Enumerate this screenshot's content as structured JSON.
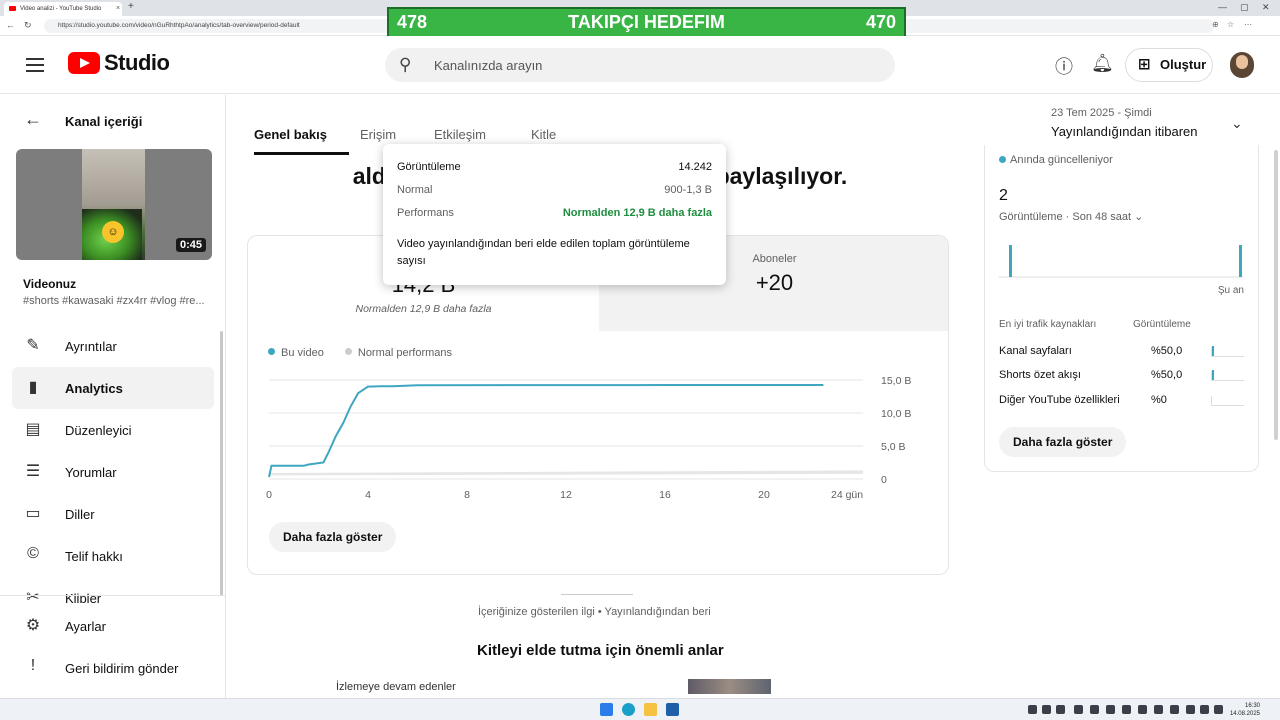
{
  "browser": {
    "tab_title": "Video analizi - YouTube Studio",
    "tab_close": "×",
    "new_tab": "+",
    "url": "https://studio.youtube.com/video/nGuRhthtpAo/analytics/tab-overview/period-default",
    "win_min": "—",
    "win_max": "▢",
    "win_close": "✕"
  },
  "banner": {
    "left": "478",
    "center": "TAKIPÇI HEDEFIM",
    "right": "470"
  },
  "header": {
    "logo_text": "Studio",
    "search_placeholder": "Kanalınızda arayın",
    "create_label": "Oluştur"
  },
  "sidebar": {
    "back_label": "Kanal içeriği",
    "duration": "0:45",
    "video_title": "Videonuz",
    "video_desc": "#shorts #kawasaki #zx4rr #vlog #re...",
    "items": [
      {
        "label": "Ayrıntılar",
        "icon": "✎"
      },
      {
        "label": "Analytics",
        "icon": "▮"
      },
      {
        "label": "Düzenleyici",
        "icon": "▤"
      },
      {
        "label": "Yorumlar",
        "icon": "☰"
      },
      {
        "label": "Diller",
        "icon": "▭"
      },
      {
        "label": "Telif hakkı",
        "icon": "©"
      },
      {
        "label": "Klipler",
        "icon": "✂"
      }
    ],
    "bottom_items": [
      {
        "label": "Ayarlar",
        "icon": "⚙"
      },
      {
        "label": "Geri bildirim gönder",
        "icon": "!"
      }
    ]
  },
  "tabs": {
    "items": [
      "Genel bakış",
      "Erişim",
      "Etkileşim",
      "Kitle"
    ],
    "date_sub": "23 Tem 2025 - Şimdi",
    "date_main": "Yayınlandığından itibaren"
  },
  "main": {
    "headline": "Çekiliş: gö... aldın... a paylaşılıyor.",
    "headline_left": "aldın",
    "headline_right": "a paylaşılıyor.",
    "metric_views_value": "14,2 B",
    "metric_views_note": "Normalden 12,9 B daha fazla",
    "metric_subs_label": "Aboneler",
    "metric_subs_value": "+20",
    "legend_this": "Bu video",
    "legend_normal": "Normal performans",
    "more_button": "Daha fazla göster",
    "below_note": "İçeriğinize gösterilen ilgi • Yayınlandığından beri",
    "section_title": "Kitleyi elde tutma için önemli anlar",
    "retain_label": "İzlemeye devam edenler"
  },
  "tooltip": {
    "rows": [
      {
        "k": "Görüntüleme",
        "v": "14.242"
      },
      {
        "k": "Normal",
        "v": "900-1,3 B"
      },
      {
        "k": "Performans",
        "v": "Normalden 12,9 B daha fazla"
      }
    ],
    "description": "Video yayınlandığından beri elde edilen toplam görüntüleme sayısı"
  },
  "right_panel": {
    "live_label": "Anında güncelleniyor",
    "count": "2",
    "count_sub": "Görüntüleme · Son 48 saat",
    "now_label": "Şu an",
    "sources_header": "En iyi trafik kaynakları",
    "views_header": "Görüntüleme",
    "sources": [
      {
        "name": "Kanal sayfaları",
        "value": "%50,0",
        "share": 0.5
      },
      {
        "name": "Shorts özet akışı",
        "value": "%50,0",
        "share": 0.5
      },
      {
        "name": "Diğer YouTube özellikleri",
        "value": "%0",
        "share": 0
      }
    ],
    "more_button": "Daha fazla göster"
  },
  "taskbar": {
    "time": "16:30",
    "date": "14.08.2025"
  },
  "colors": {
    "accent": "#3ea6c1",
    "positive": "#1e8e3e",
    "banner": "#38b544",
    "brand": "#ff0000"
  },
  "chart_data": {
    "type": "line",
    "xlabel": "",
    "ylabel": "",
    "x_ticks": [
      "0",
      "4",
      "8",
      "12",
      "16",
      "20",
      "24 gün"
    ],
    "y_ticks": [
      "0",
      "5,0 B",
      "10,0 B",
      "15,0 B"
    ],
    "xlim": [
      0,
      24
    ],
    "ylim": [
      0,
      15000
    ],
    "series": [
      {
        "name": "Bu video",
        "x": [
          0,
          0.1,
          1.4,
          1.6,
          2.2,
          2.4,
          2.7,
          3.0,
          3.3,
          3.6,
          4.0,
          4.5,
          5.0,
          6.0,
          10,
          16,
          22.4
        ],
        "y": [
          300,
          2000,
          2000,
          2200,
          2500,
          4000,
          6500,
          8500,
          11000,
          13000,
          14000,
          14050,
          14050,
          14200,
          14220,
          14235,
          14242
        ]
      },
      {
        "name": "Normal performans",
        "x": [
          0,
          24
        ],
        "y": [
          900,
          1300
        ]
      }
    ]
  }
}
